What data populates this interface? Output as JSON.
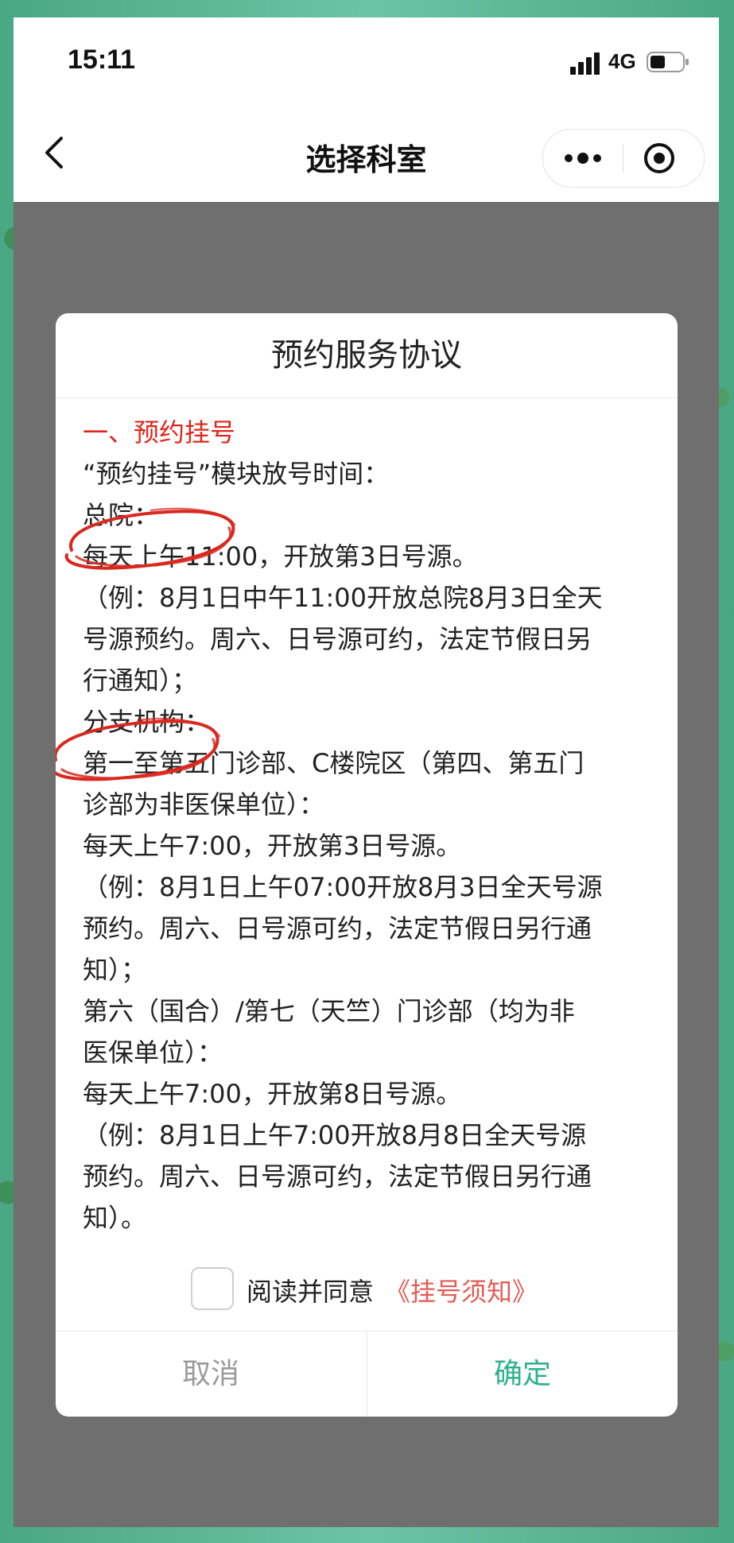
{
  "status_bar": {
    "time": "15:11",
    "network": "4G"
  },
  "nav": {
    "title": "选择科室",
    "back_icon": "chevron-left-icon",
    "more_icon": "more-dots-icon",
    "close_icon": "target-circle-icon"
  },
  "dialog": {
    "title": "预约服务协议",
    "heading": "一、预约挂号",
    "lines": [
      "“预约挂号”模块放号时间：",
      "总院：",
      "每天上午11:00，开放第3日号源。",
      "（例：8月1日中午11:00开放总院8月3日全天",
      "号源预约。周六、日号源可约，法定节假日另",
      "行通知）；",
      "分支机构：",
      "第一至第五门诊部、C楼院区（第四、第五门",
      "诊部为非医保单位）：",
      "每天上午7:00，开放第3日号源。",
      "（例：8月1日上午07:00开放8月3日全天号源",
      "预约。周六、日号源可约，法定节假日另行通",
      "知）；",
      "第六（国合）/第七（天竺）门诊部（均为非",
      "医保单位）：",
      "每天上午7:00，开放第8日号源。",
      "（例：8月1日上午7:00开放8月8日全天号源",
      "预约。周六、日号源可约，法定节假日另行通",
      "知）。"
    ],
    "agree_label": "阅读并同意",
    "notice_link": "《挂号须知》",
    "checkbox_checked": false,
    "cancel_label": "取消",
    "confirm_label": "确定",
    "colors": {
      "heading": "#e1251b",
      "link": "#e45a55",
      "confirm": "#2db28f",
      "cancel": "#9a9a9a",
      "annotation": "#d9291f"
    }
  }
}
